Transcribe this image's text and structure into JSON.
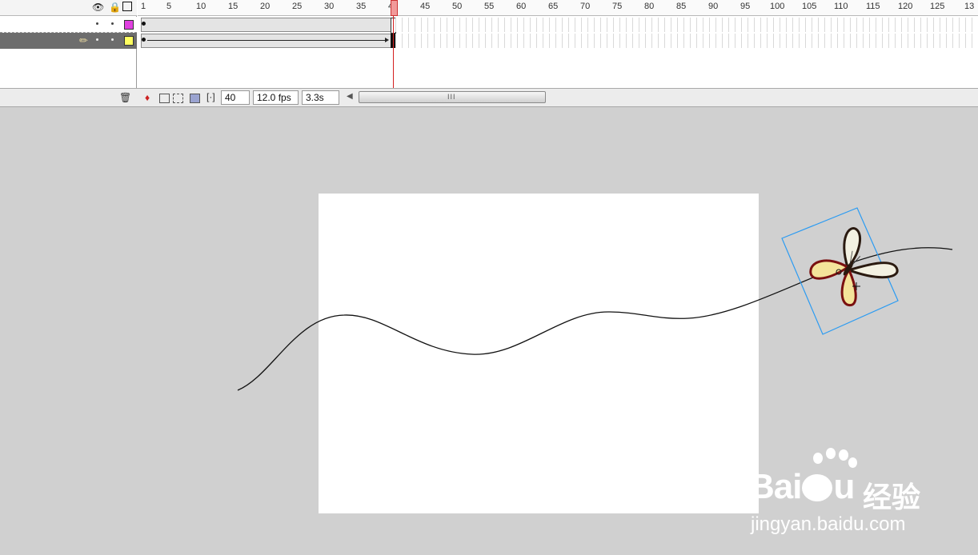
{
  "timeline": {
    "ruler_ticks": [
      "1",
      "5",
      "10",
      "15",
      "20",
      "25",
      "30",
      "35",
      "40",
      "45",
      "50",
      "55",
      "60",
      "65",
      "70",
      "75",
      "80",
      "85",
      "90",
      "95",
      "100",
      "105",
      "110",
      "115",
      "120",
      "125",
      "13"
    ],
    "header_icons": {
      "eye": "eye-icon",
      "lock": "lock-icon",
      "outline": "outline-square-icon"
    },
    "layers": [
      {
        "color": "#e040e0",
        "name": ""
      },
      {
        "color": "#ffff60",
        "name": ""
      }
    ],
    "current_frame": 40
  },
  "statusbar": {
    "frame": "40",
    "fps": "12.0 fps",
    "time": "3.3s",
    "scroll_grip": "III"
  },
  "watermark": {
    "brand": "Bai",
    "brand_tail": "u",
    "cn": "经验",
    "url": "jingyan.baidu.com"
  },
  "colors": {
    "stage": "#ffffff",
    "pasteboard": "#d0d0d0",
    "selection": "#2b9bf2",
    "playhead": "#d42020"
  }
}
